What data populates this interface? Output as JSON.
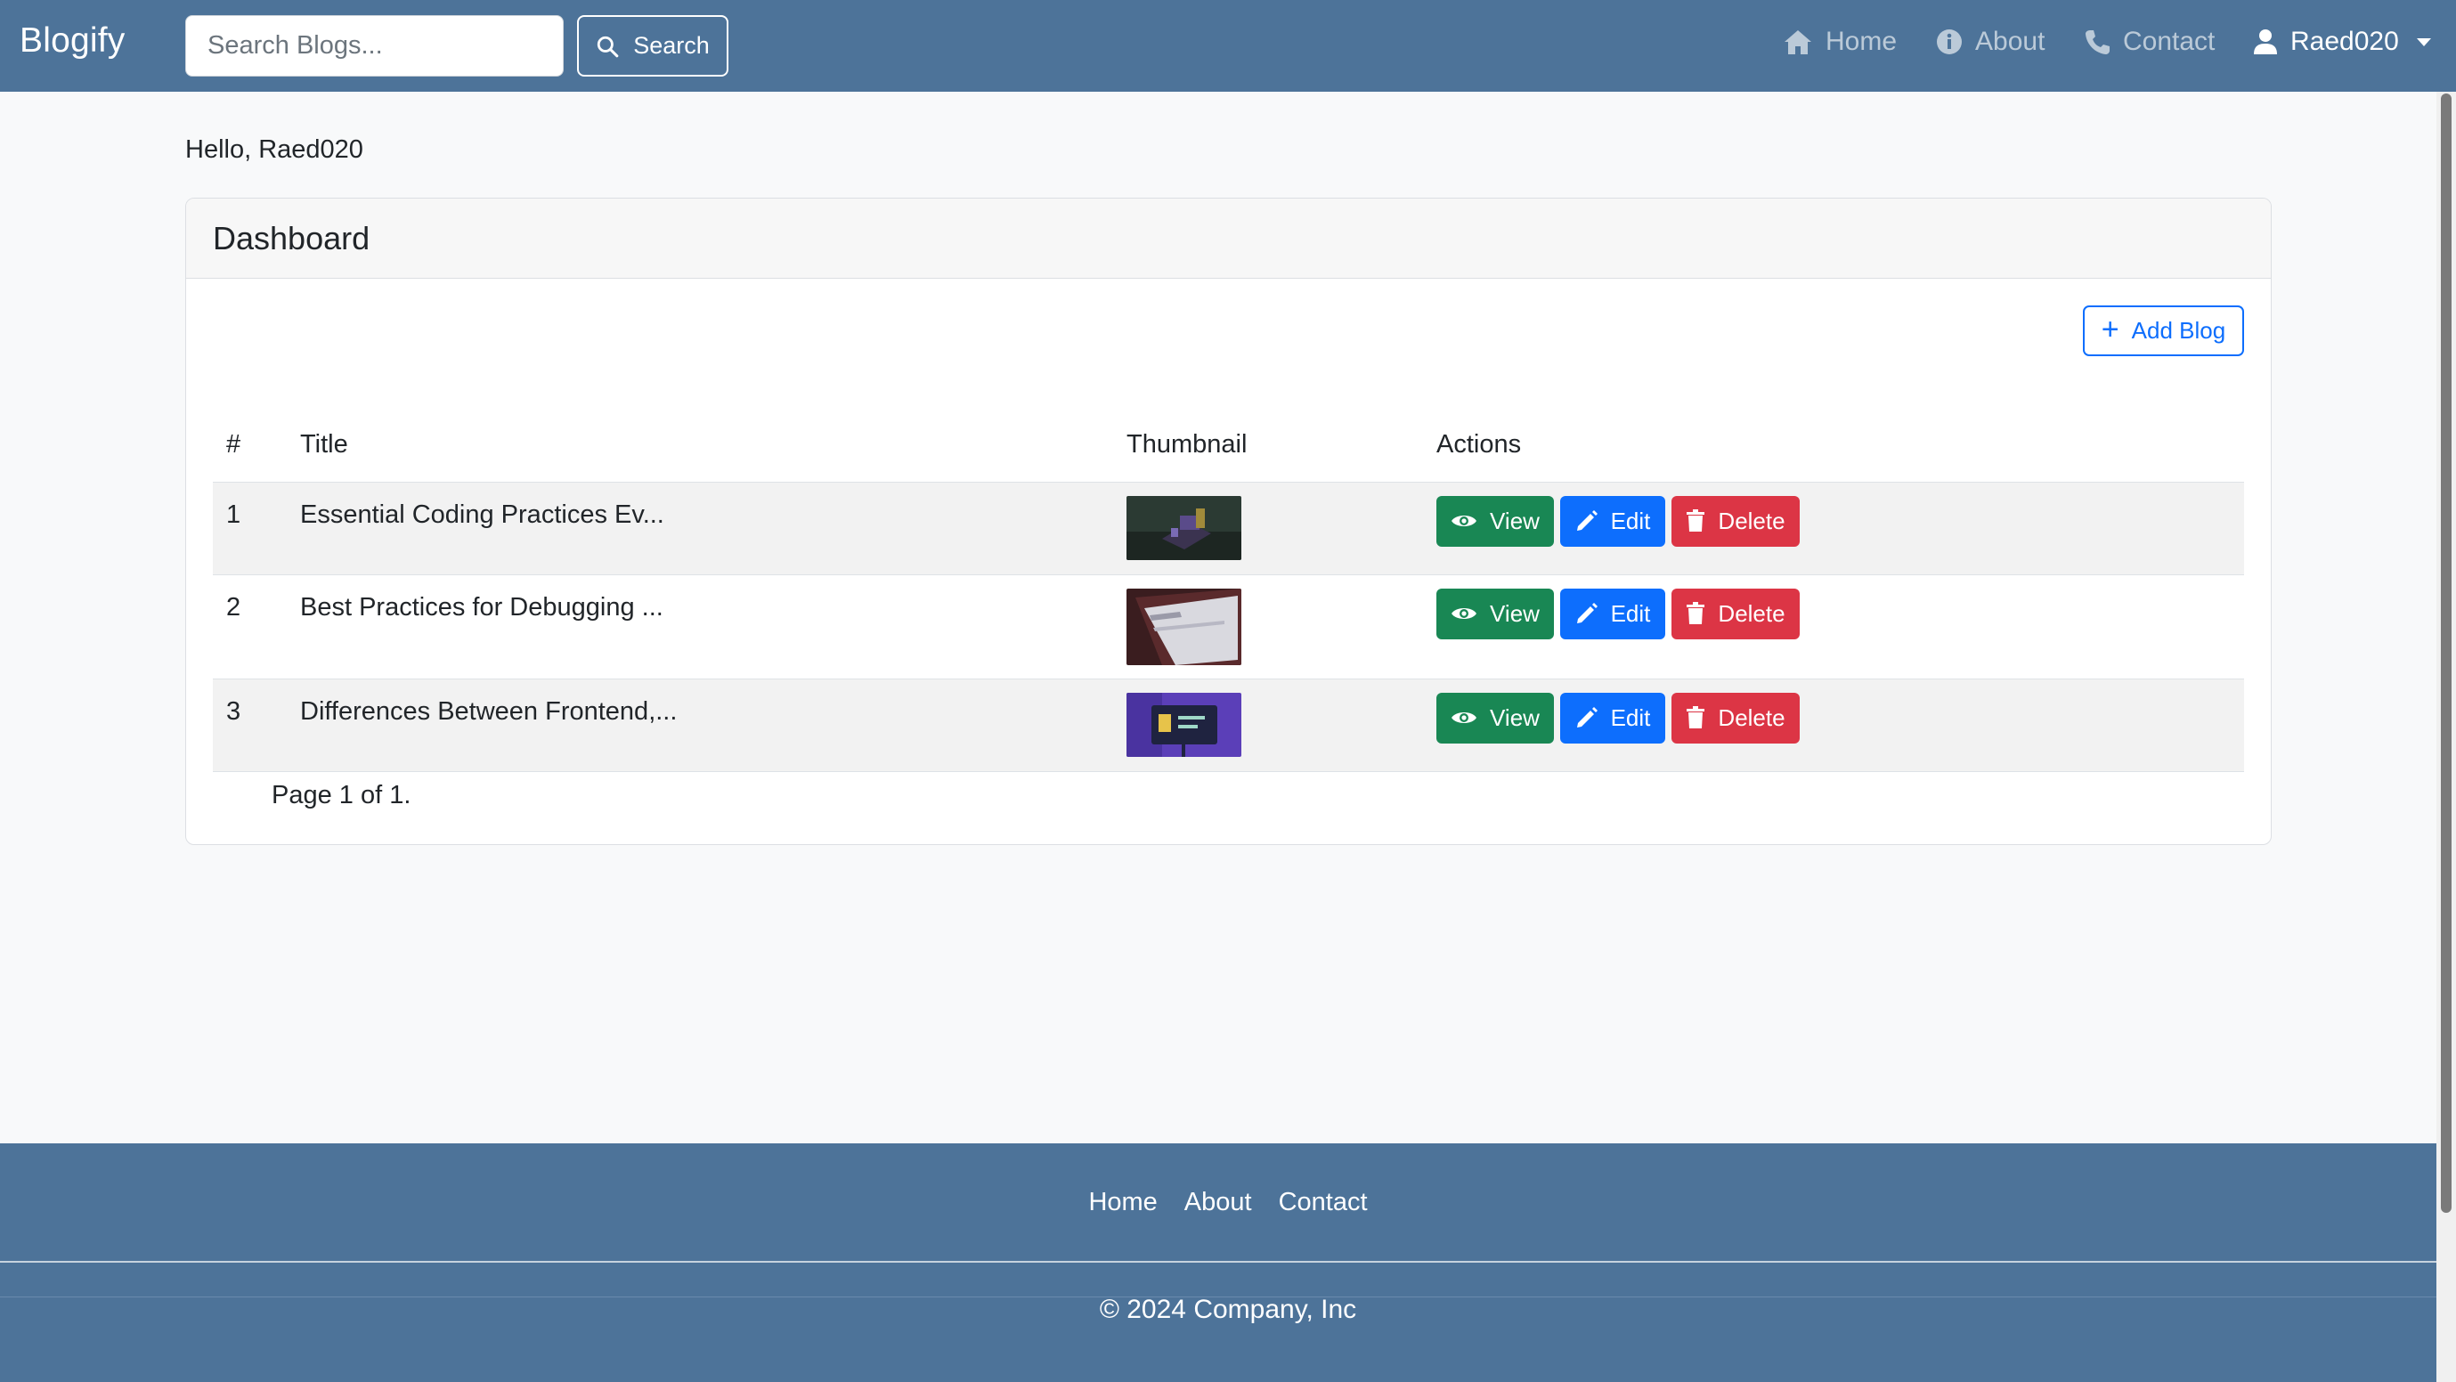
{
  "navbar": {
    "brand": "Blogify",
    "search_placeholder": "Search Blogs...",
    "search_button": "Search",
    "links": [
      {
        "label": "Home",
        "icon": "home-icon"
      },
      {
        "label": "About",
        "icon": "info-icon"
      },
      {
        "label": "Contact",
        "icon": "phone-icon"
      }
    ],
    "user": {
      "label": "Raed020",
      "icon": "user-icon"
    }
  },
  "main": {
    "greeting": "Hello, Raed020",
    "card_title": "Dashboard",
    "add_button": "Add Blog",
    "table": {
      "headers": [
        "#",
        "Title",
        "Thumbnail",
        "Actions"
      ],
      "rows": [
        {
          "num": "1",
          "title": "Essential Coding Practices Ev..."
        },
        {
          "num": "2",
          "title": "Best Practices for Debugging ..."
        },
        {
          "num": "3",
          "title": "Differences Between Frontend,..."
        }
      ],
      "actions": {
        "view": "View",
        "edit": "Edit",
        "delete": "Delete"
      }
    },
    "pagination": "Page 1 of 1."
  },
  "footer": {
    "links": [
      "Home",
      "About",
      "Contact"
    ],
    "copyright": "© 2024 Company, Inc"
  },
  "colors": {
    "navbar": "#4d7399",
    "primary": "#0d6efd",
    "success": "#198754",
    "danger": "#dc3545"
  }
}
